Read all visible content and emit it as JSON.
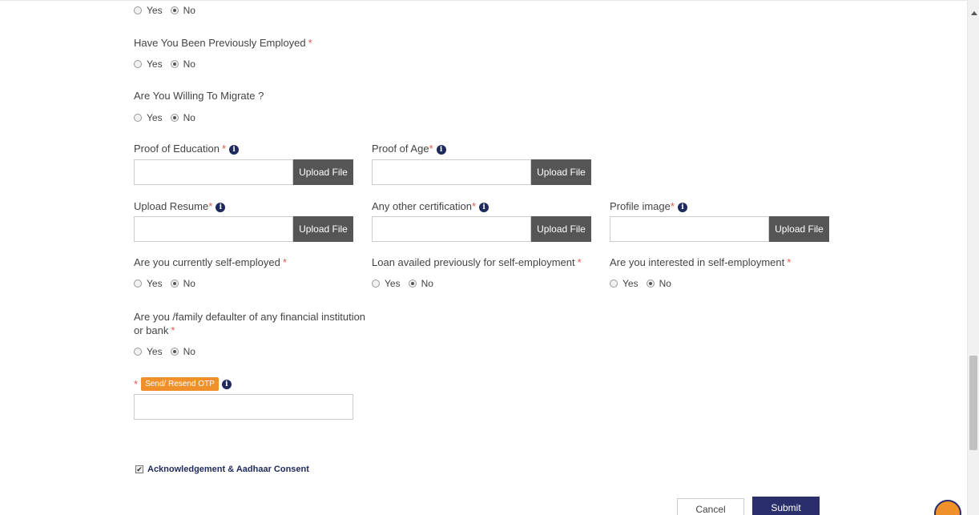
{
  "radio_options": {
    "yes": "Yes",
    "no": "No"
  },
  "questions": {
    "top_partial": {
      "selected": "No"
    },
    "previously_employed": {
      "label": "Have You Been Previously Employed",
      "required_mark": "*",
      "selected": "No"
    },
    "willing_migrate": {
      "label": "Are You Willing To Migrate ?",
      "selected": "No"
    },
    "self_employed": {
      "label": "Are you currently self-employed",
      "required_mark": "*",
      "selected": "No"
    },
    "loan_availed": {
      "label": "Loan availed previously for self-employment",
      "required_mark": "*",
      "selected": "No"
    },
    "interested_self_employment": {
      "label": "Are you interested in self-employment",
      "required_mark": "*",
      "selected": "No"
    },
    "defaulter": {
      "label_line1": "Are you /family defaulter of any financial institution",
      "label_line2": "or bank",
      "required_mark": "*",
      "selected": "No"
    }
  },
  "uploads": {
    "proof_education": {
      "label": "Proof of Education",
      "required_mark": "*",
      "button": "Upload File",
      "value": ""
    },
    "proof_age": {
      "label": "Proof of Age",
      "required_mark": "*",
      "button": "Upload File",
      "value": ""
    },
    "resume": {
      "label": "Upload Resume",
      "required_mark": "*",
      "button": "Upload File",
      "value": ""
    },
    "other_cert": {
      "label": "Any other certification",
      "required_mark": "*",
      "button": "Upload File",
      "value": ""
    },
    "profile_image": {
      "label": "Profile image",
      "required_mark": "*",
      "button": "Upload File",
      "value": ""
    }
  },
  "info_icon_glyph": "i",
  "otp": {
    "required_mark": "*",
    "button": "Send/ Resend OTP",
    "value": ""
  },
  "acknowledgement": {
    "label": "Acknowledgement & Aadhaar Consent",
    "checked": true,
    "check_glyph": "✔"
  },
  "actions": {
    "cancel": "Cancel",
    "submit": "Submit"
  },
  "colors": {
    "accent_orange": "#f0902a",
    "navy": "#2a2f6b",
    "required_red": "#e0564f",
    "upload_button": "#555555"
  }
}
